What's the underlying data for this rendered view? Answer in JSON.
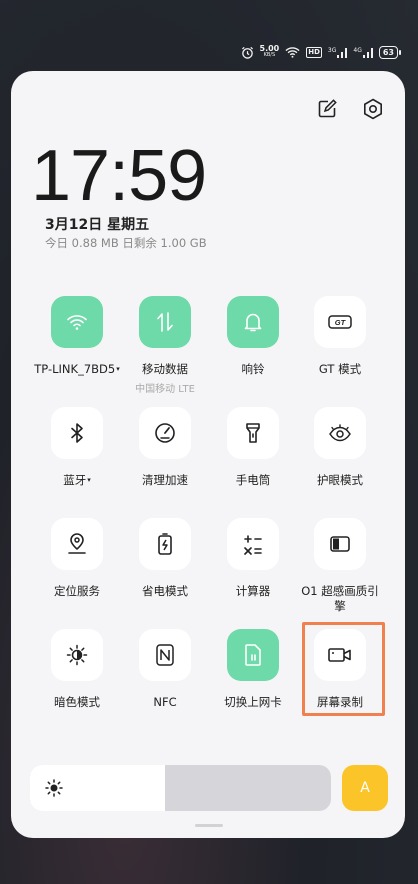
{
  "status_bar": {
    "net_speed_value": "5.00",
    "net_speed_unit": "KB/S",
    "hd_badge": "HD",
    "sim1_type": "3G",
    "sim2_type": "4G",
    "battery": "63",
    "icons": [
      "alarm-icon",
      "wifi-icon",
      "signal-icon",
      "signal-icon",
      "battery-icon"
    ]
  },
  "panel": {
    "clock": "17:59",
    "date": "3月12日  星期五",
    "data_usage": "今日 0.88 MB 日剩余 1.00 GB",
    "top_icons": [
      "edit-icon",
      "settings-icon"
    ]
  },
  "tiles": [
    {
      "label": "TP-LINK_7BD5",
      "caret": "▾",
      "icon": "wifi-icon",
      "active": true
    },
    {
      "label": "移动数据",
      "sub": "中国移动 LTE",
      "icon": "mobile-data-icon",
      "active": true
    },
    {
      "label": "响铃",
      "icon": "bell-icon",
      "active": true
    },
    {
      "label": "GT 模式",
      "icon": "gt-mode-icon",
      "active": false
    },
    {
      "label": "蓝牙",
      "caret": "▾",
      "icon": "bluetooth-icon",
      "active": false
    },
    {
      "label": "清理加速",
      "icon": "speedometer-icon",
      "active": false
    },
    {
      "label": "手电筒",
      "icon": "flashlight-icon",
      "active": false
    },
    {
      "label": "护眼模式",
      "icon": "eye-icon",
      "active": false
    },
    {
      "label": "定位服务",
      "icon": "location-icon",
      "active": false
    },
    {
      "label": "省电模式",
      "icon": "battery-saver-icon",
      "active": false
    },
    {
      "label": "计算器",
      "icon": "calculator-icon",
      "active": false
    },
    {
      "label": "O1 超感画质引擎",
      "icon": "display-engine-icon",
      "active": false
    },
    {
      "label": "暗色模式",
      "icon": "dark-mode-icon",
      "active": false
    },
    {
      "label": "NFC",
      "icon": "nfc-icon",
      "active": false
    },
    {
      "label": "切换上网卡",
      "icon": "sim-card-icon",
      "active": true
    },
    {
      "label": "屏幕录制",
      "icon": "screen-record-icon",
      "active": false
    }
  ],
  "brightness": {
    "level": 0.45,
    "icon": "sun-icon"
  },
  "auto_brightness": {
    "label": "A"
  },
  "colors": {
    "active_tile": "#6ed9a9",
    "auto_button": "#fbc428",
    "highlight": "#f0804d",
    "panel_bg": "#f5f5f7"
  }
}
